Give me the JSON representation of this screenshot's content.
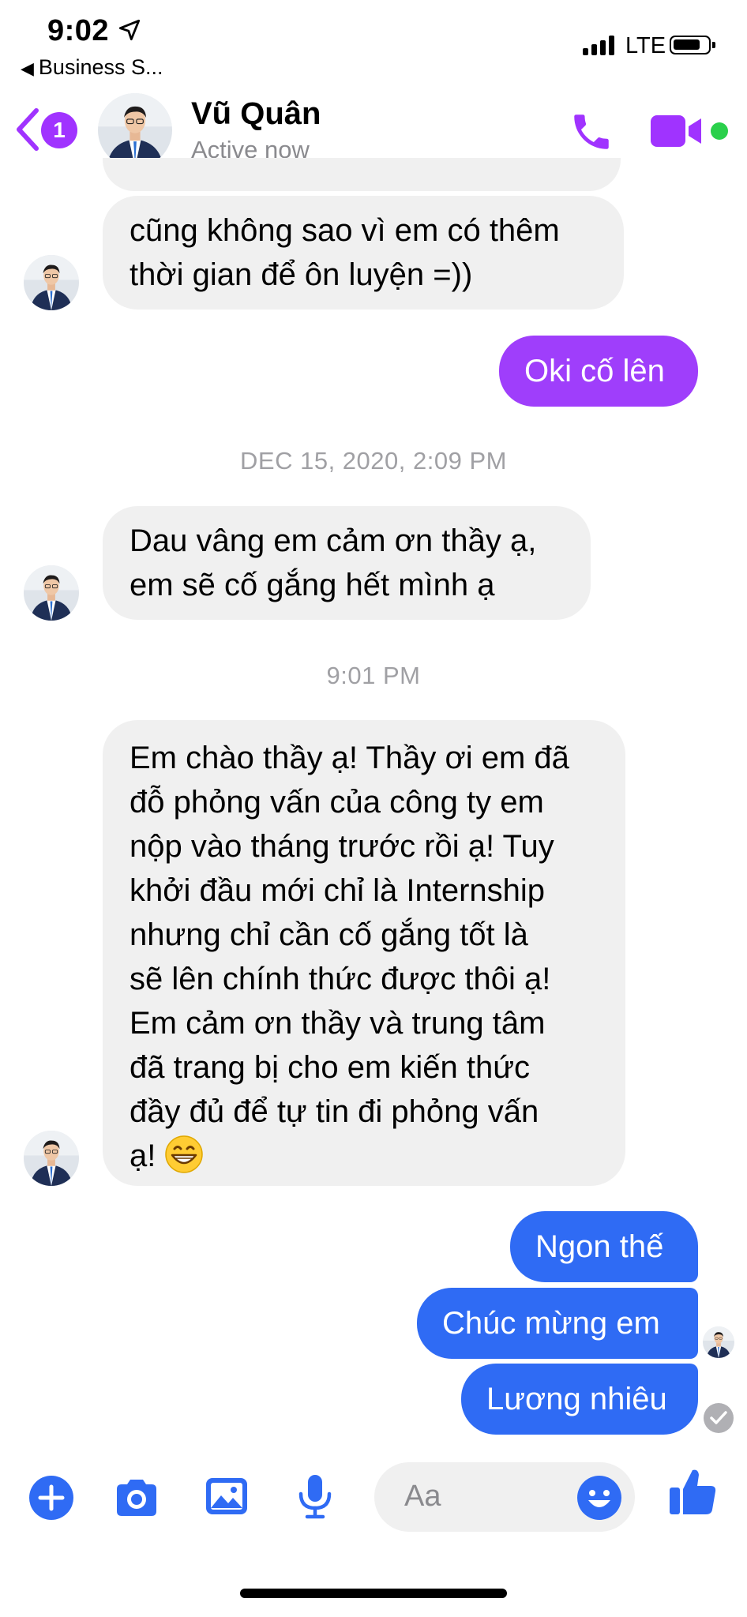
{
  "status_bar": {
    "time": "9:02",
    "back_app": "Business S...",
    "network": "LTE"
  },
  "header": {
    "unread_count": "1",
    "contact_name": "Vũ Quân",
    "contact_status": "Active now"
  },
  "messages": {
    "m0_line1": "cũng không sao vì em có thêm",
    "m0_line2": "thời gian để ôn luyện =))",
    "m1": "Oki cố lên",
    "stamp1": "DEC 15, 2020, 2:09 PM",
    "m2_line1": "Dau vâng em cảm ơn thầy ạ,",
    "m2_line2": "em sẽ cố gắng hết mình ạ",
    "stamp2": "9:01 PM",
    "m3_lines": [
      "Em chào thầy ạ! Thầy ơi em đã",
      "đỗ phỏng vấn của công ty em",
      "nộp vào tháng trước rồi ạ! Tuy",
      "khởi đầu mới chỉ là Internship",
      "nhưng chỉ cần cố gắng tốt là",
      "sẽ lên chính thức được thôi ạ!",
      "Em cảm ơn thầy và trung tâm",
      "đã trang bị cho em kiến thức",
      "đầy đủ để tự tin đi phỏng vấn",
      "ạ!"
    ],
    "m4": "Ngon thế",
    "m5": "Chúc mừng em",
    "m6": "Lương nhiêu"
  },
  "composer": {
    "placeholder": "Aa"
  },
  "colors": {
    "purple_bubble": "#9f3efb",
    "blue_bubble": "#2f6bf4",
    "incoming_bubble": "#f0f0f0",
    "messenger_blue": "#2f6bf4",
    "header_purple": "#a033ff",
    "online_green": "#2ad04b"
  },
  "icons": {
    "back": "chevron-left-icon",
    "call": "phone-icon",
    "video": "video-camera-icon",
    "add": "plus-circle-icon",
    "camera": "camera-icon",
    "gallery": "image-icon",
    "voice": "microphone-icon",
    "emoji": "smiley-icon",
    "like": "thumbs-up-icon",
    "seen": "check-circle-icon"
  }
}
